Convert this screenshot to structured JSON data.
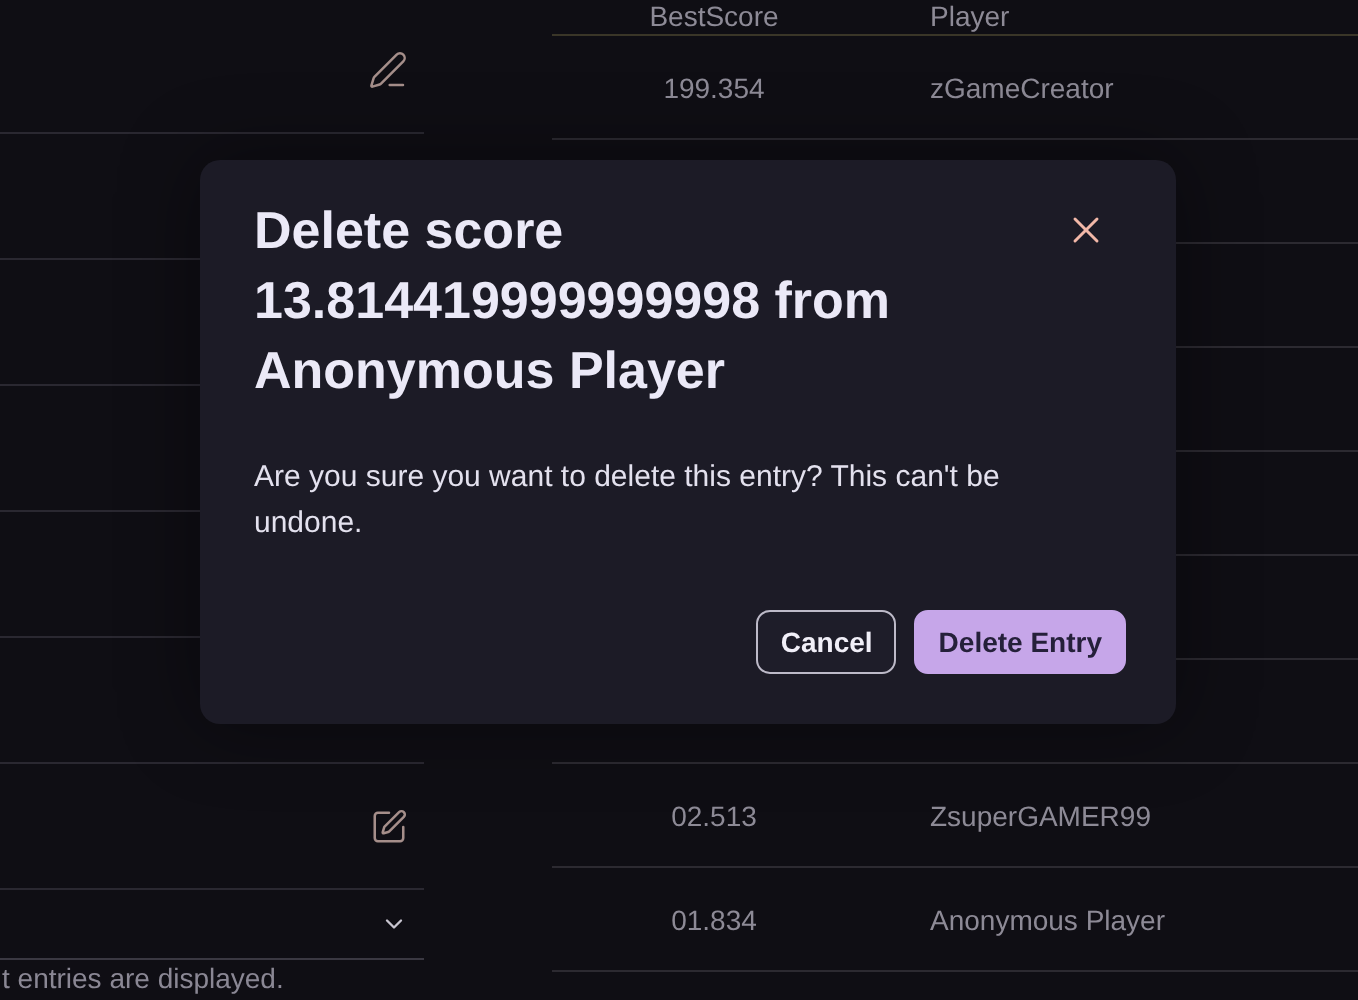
{
  "left_panel": {
    "rows": [
      {
        "kind": "pen"
      },
      {
        "kind": "empty"
      },
      {
        "kind": "empty"
      },
      {
        "kind": "empty"
      },
      {
        "kind": "empty"
      },
      {
        "kind": "empty"
      },
      {
        "kind": "edit"
      },
      {
        "kind": "select"
      }
    ],
    "footer": "t entries are displayed."
  },
  "table": {
    "columns": [
      "BestScore",
      "Player"
    ],
    "rows": [
      {
        "score": "199.354",
        "player": "zGameCreator"
      },
      {
        "score": "",
        "player": ""
      },
      {
        "score": "",
        "player": ""
      },
      {
        "score": "",
        "player": ""
      },
      {
        "score": "",
        "player": ""
      },
      {
        "score": "",
        "player": ""
      },
      {
        "score": "",
        "player": ""
      },
      {
        "score": "02.513",
        "player": "ZsuperGAMER99"
      },
      {
        "score": "01.834",
        "player": "Anonymous Player"
      }
    ]
  },
  "dialog": {
    "title": "Delete score 13.814419999999998 from Anonymous Player",
    "message": "Are you sure you want to delete this entry? This can't be undone.",
    "buttons": [
      {
        "label": "Cancel",
        "kind": "secondary"
      },
      {
        "label": "Delete Entry",
        "kind": "primary"
      }
    ]
  }
}
